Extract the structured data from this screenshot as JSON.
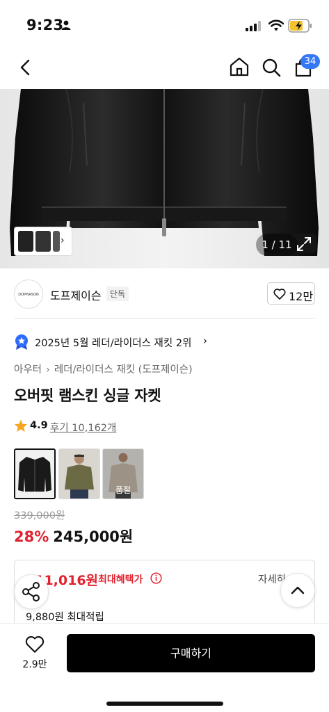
{
  "status_bar": {
    "time": "9:23"
  },
  "nav": {
    "cart_count": "34"
  },
  "gallery": {
    "counter": "1 / 11"
  },
  "brand": {
    "logo_text": "DOPPJASON",
    "name": "도프제이슨",
    "tag": "단독",
    "likes": "12만"
  },
  "ranking": {
    "text": "2025년 5월 레더/라이더스 재킷 2위"
  },
  "category": {
    "parent": "아우터",
    "child": "레더/라이더스 재킷 (도프제이슨)"
  },
  "product": {
    "title": "오버핏 램스킨 싱글 자켓",
    "rating": "4.9",
    "reviews": "후기 10,162개"
  },
  "variants": [
    {
      "soldout": ""
    },
    {
      "soldout": ""
    },
    {
      "soldout": "품절"
    }
  ],
  "price": {
    "original": "339,000원",
    "discount_rate": "28%",
    "final": "245,000원"
  },
  "benefit": {
    "max_price": "211,016원",
    "max_label": "최대혜택가",
    "detail_label": "자세히",
    "points": "9,880원 최대적립"
  },
  "bottom_bar": {
    "wish_count": "2.9만",
    "buy_label": "구매하기"
  },
  "colors": {
    "accent_red": "#e1232f",
    "badge_blue": "#3478f6"
  }
}
